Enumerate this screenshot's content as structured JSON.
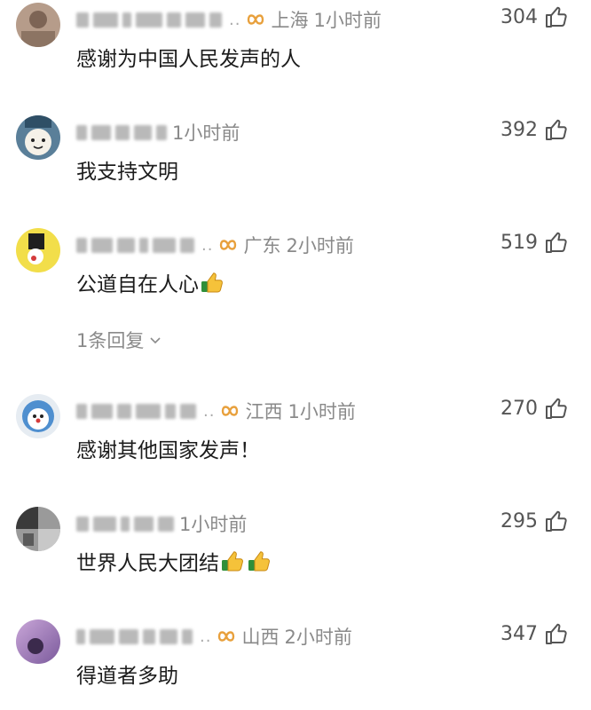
{
  "comments": [
    {
      "location": "上海",
      "time": "1小时前",
      "likes": "304",
      "text": "感谢为中国人民发声的人",
      "has_badge": true,
      "has_dots": true
    },
    {
      "location": "",
      "time": "1小时前",
      "likes": "392",
      "text": "我支持文明",
      "has_badge": false,
      "has_dots": false
    },
    {
      "location": "广东",
      "time": "2小时前",
      "likes": "519",
      "text": "公道自在人心",
      "has_badge": true,
      "has_dots": true,
      "emojis": [
        "thumbs-up"
      ],
      "reply_toggle": "1条回复"
    },
    {
      "location": "江西",
      "time": "1小时前",
      "likes": "270",
      "text": "感谢其他国家发声！",
      "has_badge": true,
      "has_dots": true
    },
    {
      "location": "",
      "time": "1小时前",
      "likes": "295",
      "text": "世界人民大团结",
      "has_badge": false,
      "has_dots": false,
      "emojis": [
        "thumbs-up",
        "thumbs-up"
      ]
    },
    {
      "location": "山西",
      "time": "2小时前",
      "likes": "347",
      "text": "得道者多助",
      "has_badge": true,
      "has_dots": true
    }
  ],
  "dots": "..",
  "colors": {
    "badge": "#e8a03c",
    "meta_text": "#8a8a8a",
    "body_text": "#1c1c1c"
  },
  "icons": {
    "like": "thumb-up-outline-icon",
    "badge": "infinity-badge-icon",
    "expand": "chevron-down-icon"
  }
}
